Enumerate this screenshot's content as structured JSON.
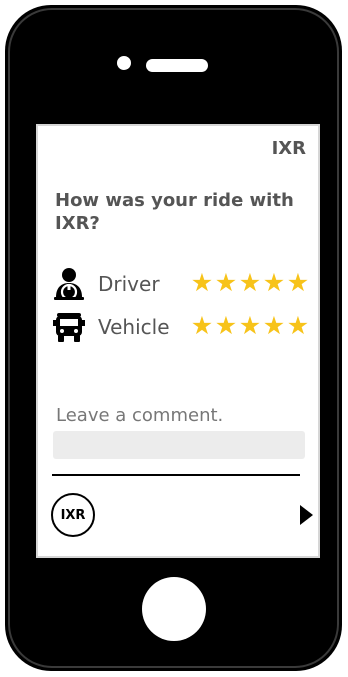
{
  "app": {
    "brand": "IXR"
  },
  "rating": {
    "question": "How was your ride with IXR?",
    "items": [
      {
        "label": "Driver",
        "icon": "driver-icon",
        "stars": 5,
        "max_stars": 5
      },
      {
        "label": "Vehicle",
        "icon": "vehicle-icon",
        "stars": 5,
        "max_stars": 5
      }
    ],
    "star_glyph": "★",
    "star_color": "#f7c31a"
  },
  "comment": {
    "placeholder": "Leave a comment.",
    "value": ""
  },
  "footer": {
    "logo_text": "IXR",
    "next_icon": "play-arrow-icon"
  },
  "device": {
    "frame_color": "#000000"
  }
}
